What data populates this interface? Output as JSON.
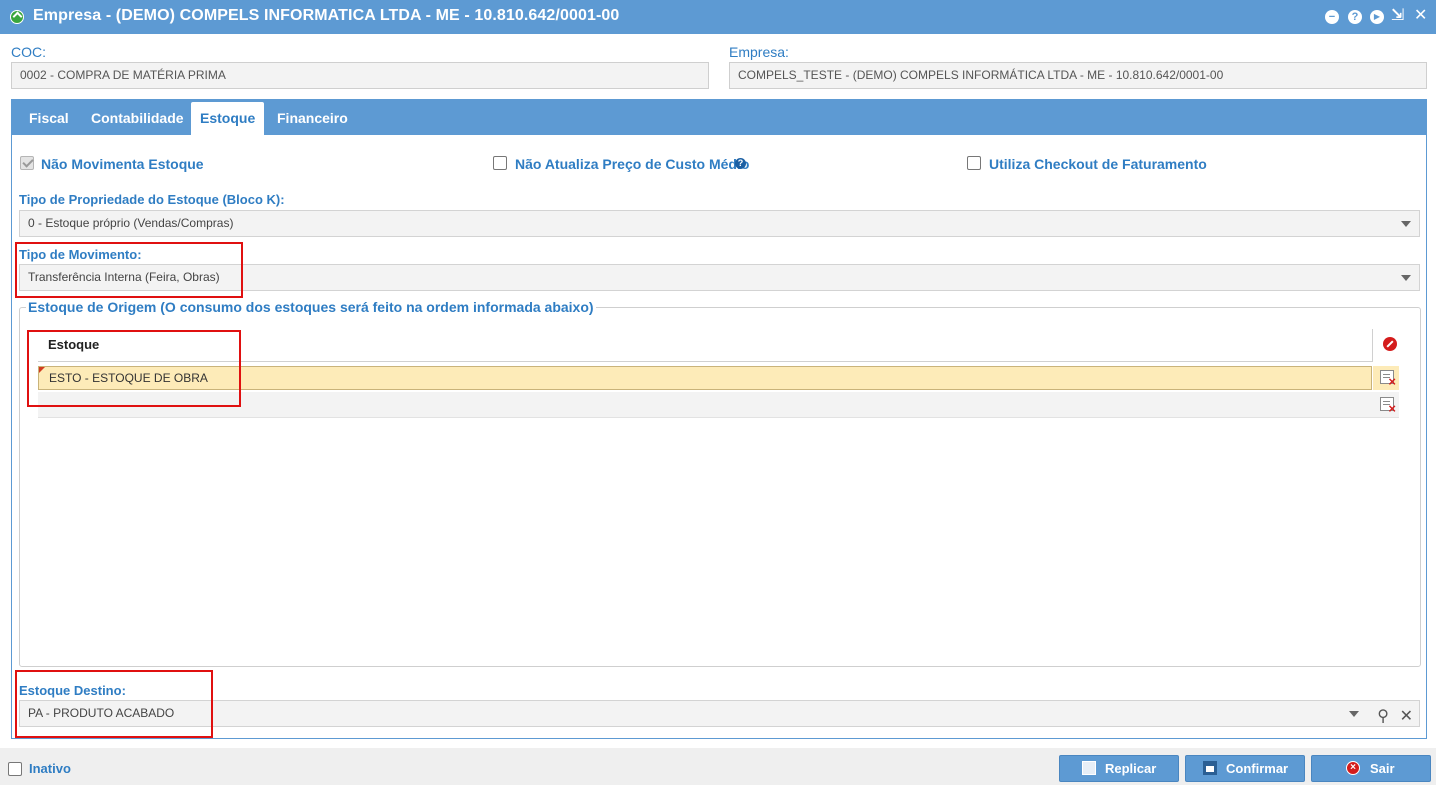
{
  "window": {
    "title": "Empresa - (DEMO) COMPELS INFORMATICA LTDA - ME - 10.810.642/0001-00",
    "help_glyph": "?",
    "play_glyph": "▶",
    "compress_glyph": "⇲",
    "close_glyph": "✕"
  },
  "header": {
    "coc_label": "COC:",
    "coc_value": "0002 - COMPRA DE MATÉRIA PRIMA",
    "empresa_label": "Empresa:",
    "empresa_value": "COMPELS_TESTE - (DEMO) COMPELS INFORMÁTICA LTDA - ME - 10.810.642/0001-00"
  },
  "tabs": [
    {
      "label": "Fiscal",
      "active": false
    },
    {
      "label": "Contabilidade",
      "active": false
    },
    {
      "label": "Estoque",
      "active": true
    },
    {
      "label": "Financeiro",
      "active": false
    }
  ],
  "estoque": {
    "nao_movimenta": {
      "label": "Não Movimenta Estoque",
      "checked": true
    },
    "nao_atualiza": {
      "label": "Não Atualiza Preço de Custo Médio",
      "checked": false,
      "help_glyph": "?"
    },
    "checkout": {
      "label": "Utiliza Checkout de Faturamento",
      "checked": false
    },
    "propriedade_label": "Tipo de Propriedade do Estoque (Bloco K):",
    "propriedade_value": "0 - Estoque próprio (Vendas/Compras)",
    "movimento_label": "Tipo de Movimento:",
    "movimento_value": "Transferência Interna (Feira, Obras)",
    "origem_legend": "Estoque de Origem (O consumo dos estoques será feito na ordem informada abaixo)",
    "grid": {
      "column": "Estoque",
      "rows": [
        "ESTO - ESTOQUE DE OBRA"
      ]
    },
    "destino_label": "Estoque Destino:",
    "destino_value": "PA - PRODUTO ACABADO"
  },
  "footer": {
    "inativo_label": "Inativo",
    "inativo_checked": false,
    "replicar": "Replicar",
    "confirmar": "Confirmar",
    "sair": "Sair"
  },
  "colors": {
    "accent": "#5d9ad3",
    "label": "#2f7dc3",
    "highlight_box": "#e01010",
    "selected_row": "#fdebb8"
  }
}
